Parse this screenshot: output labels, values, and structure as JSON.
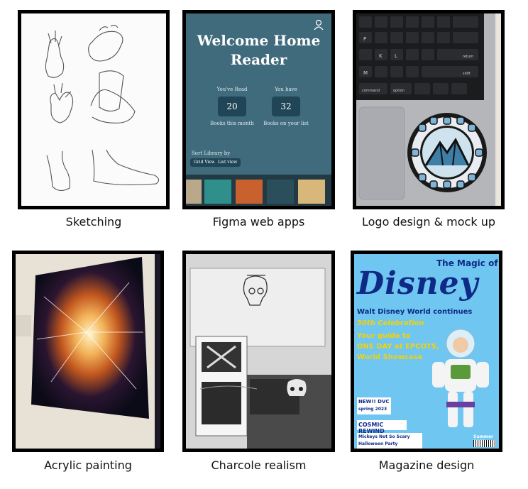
{
  "captions": {
    "sketching": "Sketching",
    "figma": "Figma web apps",
    "logo": "Logo design & mock up",
    "acrylic": "Acrylic painting",
    "charcoal": "Charcole realism",
    "magazine": "Magazine design"
  },
  "figma_app": {
    "title_line1": "Welcome Home",
    "title_line2": "Reader",
    "read_label": "You've Read",
    "read_value": "20",
    "read_sub": "Books this month",
    "have_label": "You  have",
    "have_value": "32",
    "have_sub": "Books on your list",
    "sort_label": "Sort Library by",
    "grid_btn": "Grid View",
    "list_btn": "List view"
  },
  "keyboard": {
    "keys": [
      "P",
      "K",
      "L",
      "M",
      "return",
      "shift",
      "command",
      "option"
    ]
  },
  "magazine": {
    "header": "The Magic of",
    "logo_text": "Disney",
    "line1": "Walt Disney World continues",
    "line2": "50th Celebration",
    "line3": "Your guide to",
    "line4": "ONE DAY at EPCOTS,",
    "line5": "World Showcase",
    "promo1": "NEW!! DVC",
    "promo1_sub": "spring 2023",
    "promo2": "COSMIC REWIND",
    "promo3": "Mickeys Not So Scary",
    "promo4": "Halloween Party",
    "issue": "Summer 2022"
  },
  "colors": {
    "frame": "#000000",
    "figma_bg": "#3f6b7c",
    "figma_button": "#1f4556",
    "magazine_bg": "#6fc6f0",
    "magazine_title": "#0e2a86",
    "magazine_yellow": "#f5d10a"
  }
}
